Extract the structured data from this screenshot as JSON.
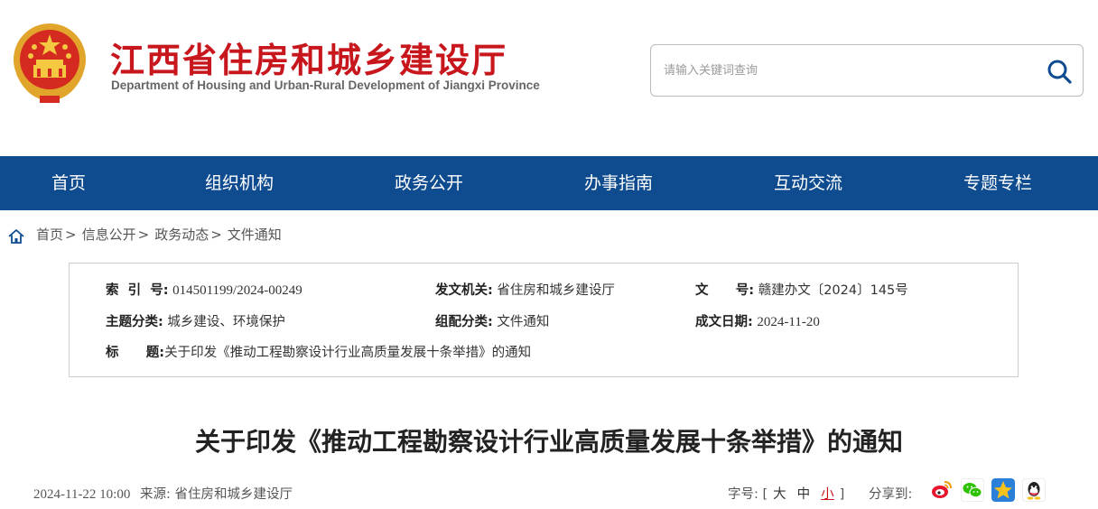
{
  "header": {
    "title": "江西省住房和城乡建设厅",
    "subtitle": "Department of Housing and Urban-Rural Development of Jiangxi Province",
    "search": {
      "placeholder": "请输入关键词查询"
    }
  },
  "nav": {
    "items": [
      {
        "label": "首页"
      },
      {
        "label": "组织机构"
      },
      {
        "label": "政务公开"
      },
      {
        "label": "办事指南"
      },
      {
        "label": "互动交流"
      },
      {
        "label": "专题专栏"
      }
    ]
  },
  "breadcrumb": {
    "items": [
      "首页",
      "信息公开",
      "政务动态",
      "文件通知"
    ],
    "separator": ">"
  },
  "info": {
    "index_key": "索  引  号:",
    "index_val": "014501199/2024-00249",
    "issuer_key": "发文机关:",
    "issuer_val": "省住房和城乡建设厅",
    "docno_key": "文      号:",
    "docno_val": "赣建办文〔2024〕145号",
    "topic_key": "主题分类:",
    "topic_val": "城乡建设、环境保护",
    "category_key": "组配分类:",
    "category_val": "文件通知",
    "date_key": "成文日期:",
    "date_val": "2024-11-20",
    "title_key": "标      题:",
    "title_val": "关于印发《推动工程勘察设计行业高质量发展十条举措》的通知"
  },
  "article": {
    "title": "关于印发《推动工程勘察设计行业高质量发展十条举措》的通知",
    "published": "2024-11-22 10:00",
    "source_label": "来源:",
    "source": "省住房和城乡建设厅",
    "fontsize_label": "字号:",
    "fontsize_open": "[",
    "fontsize_options": [
      "大",
      "中",
      "小"
    ],
    "fontsize_close": "]",
    "share_label": "分享到:"
  },
  "colors": {
    "brand_red": "#c8161d",
    "nav_blue": "#0e4b8f"
  },
  "icons": {
    "share": [
      "weibo-icon",
      "wechat-icon",
      "qzone-icon",
      "qq-icon"
    ]
  }
}
